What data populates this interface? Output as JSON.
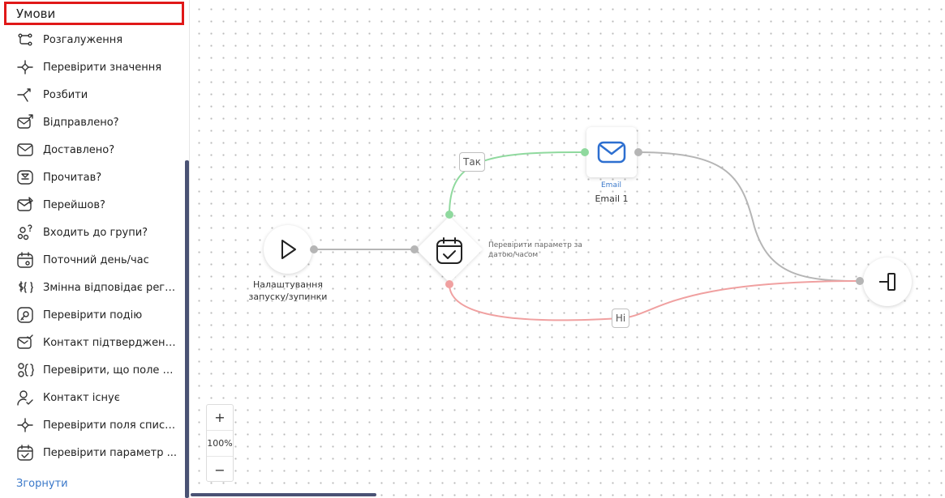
{
  "sidebar": {
    "title": "Умови",
    "items": [
      {
        "label": "Розгалуження",
        "icon": "branch-icon"
      },
      {
        "label": "Перевірити значення",
        "icon": "check-value-icon"
      },
      {
        "label": "Розбити",
        "icon": "split-icon"
      },
      {
        "label": "Відправлено?",
        "icon": "mail-sent-icon"
      },
      {
        "label": "Доставлено?",
        "icon": "mail-delivered-icon"
      },
      {
        "label": "Прочитав?",
        "icon": "mail-read-icon"
      },
      {
        "label": "Перейшов?",
        "icon": "mail-clicked-icon"
      },
      {
        "label": "Входить до групи?",
        "icon": "group-member-icon"
      },
      {
        "label": "Поточний день/час",
        "icon": "calendar-clock-icon"
      },
      {
        "label": "Змінна відповідає регу...",
        "icon": "variable-regex-icon"
      },
      {
        "label": "Перевірити подію",
        "icon": "event-check-icon"
      },
      {
        "label": "Контакт підтверджений",
        "icon": "contact-confirmed-icon"
      },
      {
        "label": "Перевірити, що поле к...",
        "icon": "field-check-icon"
      },
      {
        "label": "Контакт існує",
        "icon": "contact-exists-icon"
      },
      {
        "label": "Перевірити поля списк...",
        "icon": "list-fields-icon"
      },
      {
        "label": "Перевірити параметр ...",
        "icon": "calendar-check-icon"
      }
    ],
    "collapse_label": "Згорнути"
  },
  "flow": {
    "start_node": {
      "label_line1": "Налаштування",
      "label_line2": "запуску/зупинки",
      "icon": "play-icon"
    },
    "condition_node": {
      "label_line1": "Перевірити параметр за",
      "label_line2": "датою/часом",
      "icon": "calendar-check-icon"
    },
    "email_node": {
      "type_label": "Email",
      "name": "Email 1",
      "icon": "envelope-icon"
    },
    "exit_node": {
      "icon": "exit-icon"
    },
    "yes_label": "Так",
    "no_label": "Ні",
    "colors": {
      "yes": "#8fd99e",
      "no": "#f0a0a0",
      "neutral": "#b5b5b5",
      "accent": "#2d6fd0"
    }
  },
  "zoom": {
    "plus": "+",
    "level": "100%",
    "minus": "−"
  }
}
